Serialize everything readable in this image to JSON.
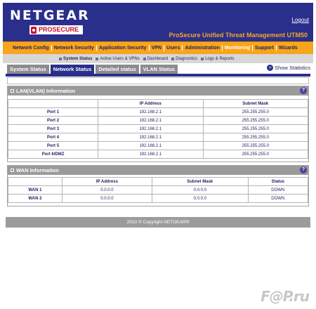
{
  "header": {
    "brand": "NETGEAR",
    "sub_brand": "PROSECURE",
    "logout": "Logout",
    "product": "ProSecure Unified Threat Management UTM50"
  },
  "main_nav": [
    "Network Config",
    "Network Security",
    "Application Security",
    "VPN",
    "Users",
    "Administration",
    "Monitoring",
    "Support",
    "Wizards"
  ],
  "sub_nav": [
    "System Status",
    "Active Users & VPNs",
    "Dashboard",
    "Diagnostics",
    "Logs & Reports"
  ],
  "tabs": [
    "System Status",
    "Network Status",
    "Detailed status",
    "VLAN Status"
  ],
  "show_statistics": "Show Statistics",
  "lan": {
    "title": "LAN(VLAN) Information",
    "headers": [
      "",
      "IP Address",
      "Subnet Mask"
    ],
    "rows": [
      {
        "label": "Port 1",
        "ip": "192.168.2.1",
        "mask": "255.255.255.0"
      },
      {
        "label": "Port 2",
        "ip": "192.168.2.1",
        "mask": "255.255.255.0"
      },
      {
        "label": "Port 3",
        "ip": "192.168.2.1",
        "mask": "255.255.255.0"
      },
      {
        "label": "Port 4",
        "ip": "192.168.2.1",
        "mask": "255.255.255.0"
      },
      {
        "label": "Port 5",
        "ip": "192.168.2.1",
        "mask": "255.255.255.0"
      },
      {
        "label": "Port 6/DMZ",
        "ip": "192.168.2.1",
        "mask": "255.255.255.0"
      }
    ]
  },
  "wan": {
    "title": "WAN Information",
    "headers": [
      "",
      "IP Address",
      "Subnet Mask",
      "Status"
    ],
    "rows": [
      {
        "label": "WAN 1",
        "ip": "0.0.0.0",
        "mask": "0.0.0.0",
        "status": "DOWN"
      },
      {
        "label": "WAN 2",
        "ip": "0.0.0.0",
        "mask": "0.0.0.0",
        "status": "DOWN"
      }
    ]
  },
  "footer": "2010 © Copyright NETGEAR®",
  "watermark": "F@P.ru",
  "colors": {
    "brand_blue": "#2a2f8c",
    "nav_orange": "#f7a51c",
    "section_gray": "#9a9a9a"
  }
}
